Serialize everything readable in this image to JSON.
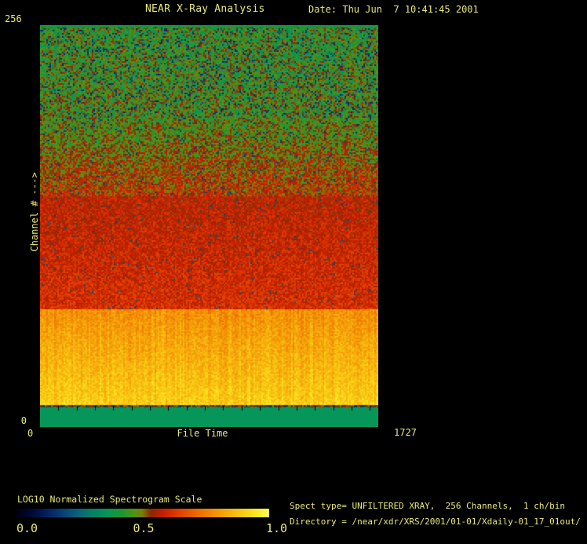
{
  "header": {
    "title": "NEAR X-Ray Analysis",
    "date": "Date: Thu Jun  7 10:41:45 2001"
  },
  "plot": {
    "y_axis": {
      "label": "Channel # --->",
      "max_tick": "256",
      "min_tick": "0"
    },
    "x_axis": {
      "label": "File Time",
      "min_tick": "0",
      "max_tick": "1727"
    }
  },
  "colorbar": {
    "label": "LOG10 Normalized Spectrogram Scale",
    "tick_0": "0.0",
    "tick_half": "0.5",
    "tick_1": "1.0"
  },
  "footer": {
    "spect_type_line": "Spect type= UNFILTERED XRAY,  256 Channels,  1 ch/bin",
    "directory_line": "Directory = /near/xdr/XRS/2001/01-01/Xdaily-01_17_01out/"
  },
  "colors": {
    "background": "#000000",
    "text": "#e9e97b",
    "tick_mark": "#000000"
  },
  "chart_data": {
    "type": "heatmap",
    "title": "NEAR X-Ray Analysis",
    "xlabel": "File Time",
    "ylabel": "Channel # --->",
    "xlim": [
      0,
      1727
    ],
    "ylim": [
      0,
      256
    ],
    "colorbar_label": "LOG10 Normalized Spectrogram Scale",
    "colorbar_ticks": [
      0.0,
      0.5,
      1.0
    ],
    "colormap_stops": [
      [
        0.0,
        "#000014"
      ],
      [
        0.07,
        "#000d3d"
      ],
      [
        0.15,
        "#06306e"
      ],
      [
        0.23,
        "#0b5c7e"
      ],
      [
        0.3,
        "#078266"
      ],
      [
        0.36,
        "#069659"
      ],
      [
        0.42,
        "#1e9732"
      ],
      [
        0.47,
        "#559412"
      ],
      [
        0.5,
        "#7e7a06"
      ],
      [
        0.53,
        "#8c2a00"
      ],
      [
        0.58,
        "#c81e00"
      ],
      [
        0.64,
        "#e13f00"
      ],
      [
        0.72,
        "#ee6d00"
      ],
      [
        0.8,
        "#f49b08"
      ],
      [
        0.88,
        "#f8c512"
      ],
      [
        0.95,
        "#fce723"
      ],
      [
        1.0,
        "#ffff55"
      ]
    ],
    "bands": [
      {
        "ch_from": 256.0,
        "ch_to": 254.5,
        "v_from": 0.4,
        "v_to": 0.4,
        "noise": 0.02,
        "dark_p": 0.0,
        "stripe": 0.0,
        "desc": "solid green top edge line"
      },
      {
        "ch_from": 254.5,
        "ch_to": 197.0,
        "v_from": 0.44,
        "v_to": 0.46,
        "noise": 0.11,
        "dark_p": 0.1,
        "stripe": 0.25,
        "desc": "noisy green high channels"
      },
      {
        "ch_from": 197.0,
        "ch_to": 147.0,
        "v_from": 0.46,
        "v_to": 0.56,
        "noise": 0.09,
        "dark_p": 0.05,
        "stripe": 0.25,
        "desc": "green-to-red transition"
      },
      {
        "ch_from": 147.0,
        "ch_to": 75.0,
        "v_from": 0.57,
        "v_to": 0.61,
        "noise": 0.055,
        "dark_p": 0.015,
        "stripe": 0.25,
        "desc": "noisy red mid channels"
      },
      {
        "ch_from": 75.0,
        "ch_to": 14.0,
        "v_from": 0.78,
        "v_to": 0.9,
        "noise": 0.045,
        "dark_p": 0.0,
        "stripe": 1.0,
        "desc": "bright orange-to-yellow low channels"
      },
      {
        "ch_from": 14.0,
        "ch_to": 12.5,
        "v_from": 0.52,
        "v_to": 0.52,
        "noise": 0.07,
        "dark_p": 0.4,
        "stripe": 0.2,
        "desc": "dark boundary row with tick marks"
      },
      {
        "ch_from": 12.5,
        "ch_to": 0.0,
        "v_from": 0.36,
        "v_to": 0.36,
        "noise": 0.0,
        "dark_p": 0.0,
        "stripe": 0.0,
        "desc": "uniform sea-green bottom band"
      }
    ],
    "bottom_tick_count": 18
  }
}
